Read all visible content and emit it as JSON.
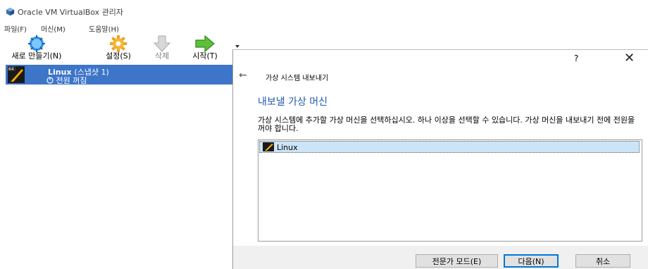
{
  "app": {
    "title": "Oracle VM VirtualBox 관리자"
  },
  "menu": [
    "파일(F)",
    "머신(M)",
    "도움말(H)"
  ],
  "toolbar": {
    "new_label": "새로 만들기(N)",
    "settings_label": "설정(S)",
    "discard_label": "삭제",
    "start_label": "시작(T)"
  },
  "vm": {
    "name": "Linux",
    "snapshot": "(스냅샷 1)",
    "state": "전원 꺼짐",
    "arch_badge": "64"
  },
  "dialog": {
    "help": "?",
    "close": "✕",
    "back": "←",
    "wizard_title": "가상 시스템 내보내기",
    "heading": "내보낼 가상 머신",
    "description": "가상 시스템에 추가할 가상 머신을 선택하십시오. 하나 이상을 선택할 수 있습니다. 가상 머신을 내보내기 전에 전원을 꺼야 합니다.",
    "vm_list": [
      "Linux"
    ],
    "buttons": {
      "expert": "전문가 모드(E)",
      "next": "다음(N)",
      "cancel": "취소"
    }
  },
  "colors": {
    "selection": "#3d75c9",
    "heading": "#1e5aa8",
    "default_button_border": "#0078d7",
    "list_selection": "#cce4f7"
  }
}
